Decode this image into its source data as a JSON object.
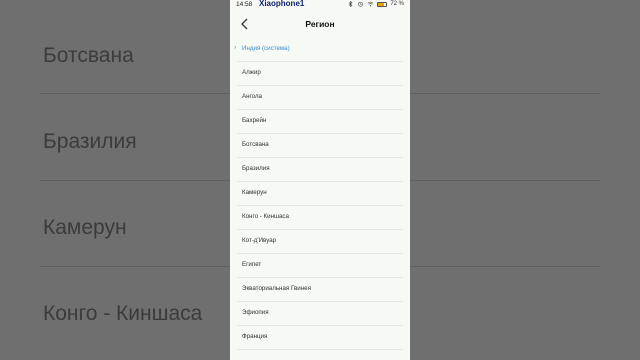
{
  "background": {
    "items": [
      "Ботсвана",
      "Бразилия",
      "Камерун",
      "Конго - Киншаса"
    ]
  },
  "statusbar": {
    "time": "14:58",
    "carrier": "Xiaophone1",
    "battery": "72 %"
  },
  "header": {
    "title": "Регион"
  },
  "regions": [
    {
      "label": "Индия (система)",
      "selected": true
    },
    {
      "label": "Алжир",
      "selected": false
    },
    {
      "label": "Ангола",
      "selected": false
    },
    {
      "label": "Бахрейн",
      "selected": false
    },
    {
      "label": "Ботсвана",
      "selected": false
    },
    {
      "label": "Бразилия",
      "selected": false
    },
    {
      "label": "Камерун",
      "selected": false
    },
    {
      "label": "Конго - Киншаса",
      "selected": false
    },
    {
      "label": "Кот-д'Ивуар",
      "selected": false
    },
    {
      "label": "Египет",
      "selected": false
    },
    {
      "label": "Экваториальная Гвинея",
      "selected": false
    },
    {
      "label": "Эфиопия",
      "selected": false
    },
    {
      "label": "Франция",
      "selected": false
    }
  ],
  "icons": {
    "back": "back-arrow-icon",
    "selected": "chevron-right-icon"
  },
  "colors": {
    "accent": "#3a8fd6",
    "carrier": "#0d1f6b",
    "background": "#6f6f6f"
  }
}
